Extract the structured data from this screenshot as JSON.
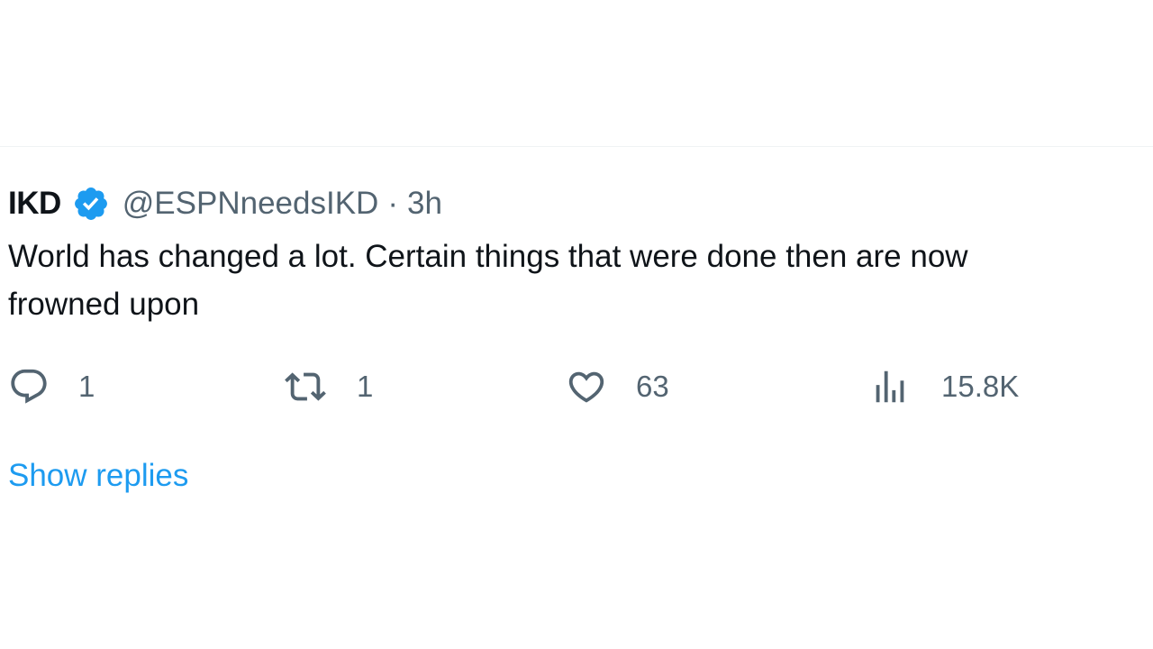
{
  "tweet": {
    "display_name": "IKD",
    "handle": "@ESPNneedsIKD",
    "separator": "·",
    "time": "3h",
    "text_line1": "World has changed a lot. Certain things that were done then are now",
    "text_line2": "frowned upon"
  },
  "actions": {
    "reply_count": "1",
    "retweet_count": "1",
    "like_count": "63",
    "views_count": "15.8K"
  },
  "show_replies_label": "Show replies",
  "icons": {
    "verified": "verified-badge-icon",
    "reply": "reply-icon",
    "retweet": "retweet-icon",
    "like": "heart-icon",
    "views": "views-chart-icon"
  },
  "colors": {
    "accent": "#1d9bf0",
    "text": "#0f1419",
    "secondary": "#536471",
    "divider": "#eff3f4"
  }
}
